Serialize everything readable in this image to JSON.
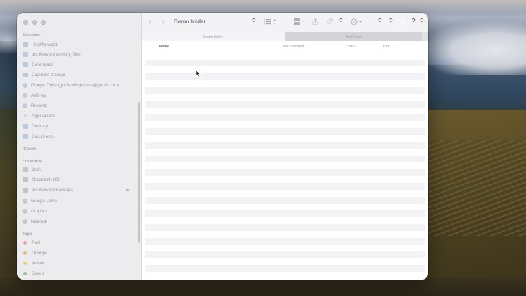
{
  "window": {
    "title": "Demo folder",
    "help_glyph": "?"
  },
  "toolbar": {
    "back": "‹",
    "forward": "›",
    "help1": "?",
    "view_list_icon": "list-view-icon",
    "group_icon": "grid-group-icon",
    "help2": "?",
    "action_icon": "ellipsis-circle-icon",
    "help3": "?",
    "help4": "?",
    "help5": "?",
    "help6": "?",
    "search_icon": "search-icon"
  },
  "tabs": [
    {
      "label": "Demo folder",
      "active": true
    },
    {
      "label": "Test kilam",
      "active": false
    }
  ],
  "tab_add": "+",
  "columns": {
    "name": "Name",
    "date_modified": "Date Modified",
    "size": "Size",
    "kind": "Kind"
  },
  "sidebar": {
    "favorites_title": "Favorites",
    "favorites": [
      {
        "label": "_techforword",
        "icon": "folder-icon"
      },
      {
        "label": "techforword working files",
        "icon": "folder-icon"
      },
      {
        "label": "Downloads",
        "icon": "folder-icon"
      },
      {
        "label": "Captures d’écran",
        "icon": "folder-icon"
      },
      {
        "label": "Google Drive (goldsmith.joshua@gmail.com)",
        "icon": "google-drive-icon"
      },
      {
        "label": "AirDrop",
        "icon": "airdrop-icon"
      },
      {
        "label": "Recents",
        "icon": "clock-icon"
      },
      {
        "label": "Applications",
        "icon": "applications-icon"
      },
      {
        "label": "Desktop",
        "icon": "desktop-icon"
      },
      {
        "label": "Documents",
        "icon": "document-icon"
      }
    ],
    "icloud_title": "iCloud",
    "locations_title": "Locations",
    "locations": [
      {
        "label": "Josh",
        "icon": "laptop-icon"
      },
      {
        "label": "Macintosh HD",
        "icon": "disk-icon"
      },
      {
        "label": "techforword backups",
        "icon": "external-disk-icon"
      },
      {
        "label": "Google Drive",
        "icon": "google-drive-icon"
      },
      {
        "label": "Dropbox",
        "icon": "dropbox-icon"
      },
      {
        "label": "Network",
        "icon": "network-icon"
      }
    ],
    "tags_title": "Tags",
    "tags": [
      {
        "label": "Red",
        "color": "#e8a49a"
      },
      {
        "label": "Orange",
        "color": "#e9b57e"
      },
      {
        "label": "Yellow",
        "color": "#e6cf73"
      },
      {
        "label": "Green",
        "color": "#8fc98b"
      }
    ]
  }
}
